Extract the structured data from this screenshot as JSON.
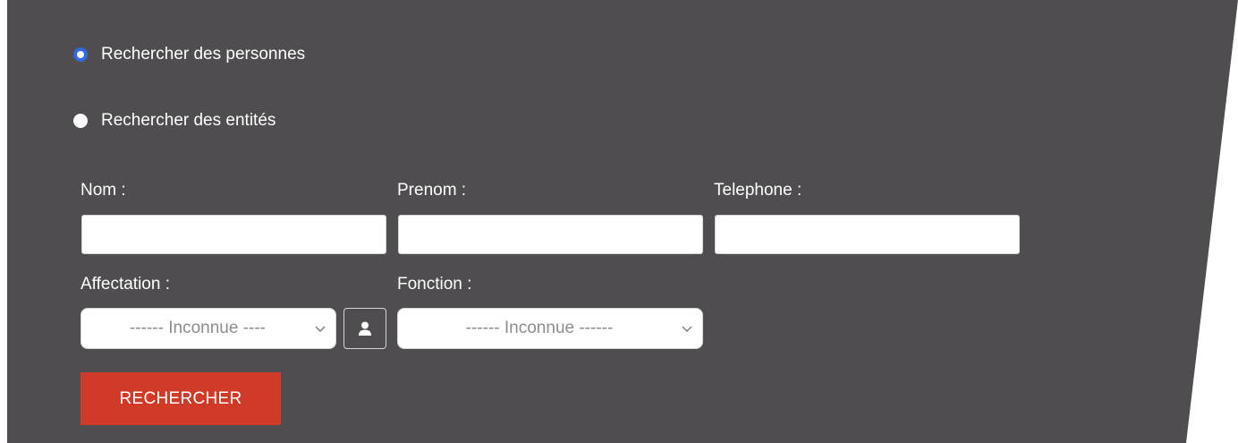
{
  "search_mode": {
    "options": [
      {
        "label": "Rechercher des personnes",
        "checked": true
      },
      {
        "label": "Rechercher des entités",
        "checked": false
      }
    ]
  },
  "fields": {
    "nom": {
      "label": "Nom :",
      "value": ""
    },
    "prenom": {
      "label": "Prenom :",
      "value": ""
    },
    "telephone": {
      "label": "Telephone :",
      "value": ""
    },
    "affectation": {
      "label": "Affectation :",
      "selected": "------ Inconnue ----"
    },
    "fonction": {
      "label": "Fonction :",
      "selected": "------ Inconnue ------"
    }
  },
  "buttons": {
    "search_label": "RECHERCHER",
    "person_icon": "user-icon"
  },
  "colors": {
    "panel_bg": "#4f4d4f",
    "accent_radio": "#2f6bdb",
    "search_button": "#d03a28",
    "text": "#ffffff"
  }
}
